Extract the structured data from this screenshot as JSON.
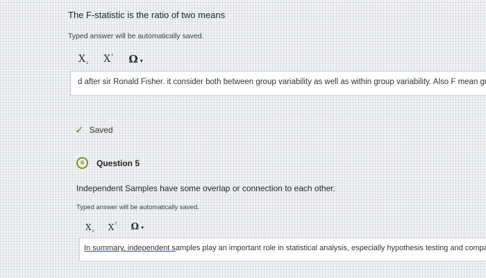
{
  "question4": {
    "prompt": "The F-statistic is the ratio of two means",
    "hint": "Typed answer will be automatically saved.",
    "toolbar": {
      "subscript_base": "X",
      "subscript_mark": "₂",
      "superscript_base": "X",
      "superscript_mark": "²",
      "omega": "Ω",
      "omega_caret": "▾"
    },
    "answer_text": "d after sir Ronald Fisher. it consider both between group variability as well as within group variability. Also F mean greater dispe",
    "saved_label": "Saved",
    "saved_icon": "check-icon"
  },
  "question5": {
    "number_label": "Question 5",
    "icon": "question-icon",
    "prompt": "Independent Samples have some overlap or connection to each other.",
    "hint": "Typed answer will be automatically saved.",
    "toolbar": {
      "subscript_base": "X",
      "subscript_mark": "₂",
      "superscript_base": "X",
      "superscript_mark": "²",
      "omega": "Ω",
      "omega_caret": "▾"
    },
    "answer_underlined": "In summary, independent s",
    "answer_rest": "amples play an important role in statistical analysis, especially hypothesis testing and comparative stu"
  }
}
